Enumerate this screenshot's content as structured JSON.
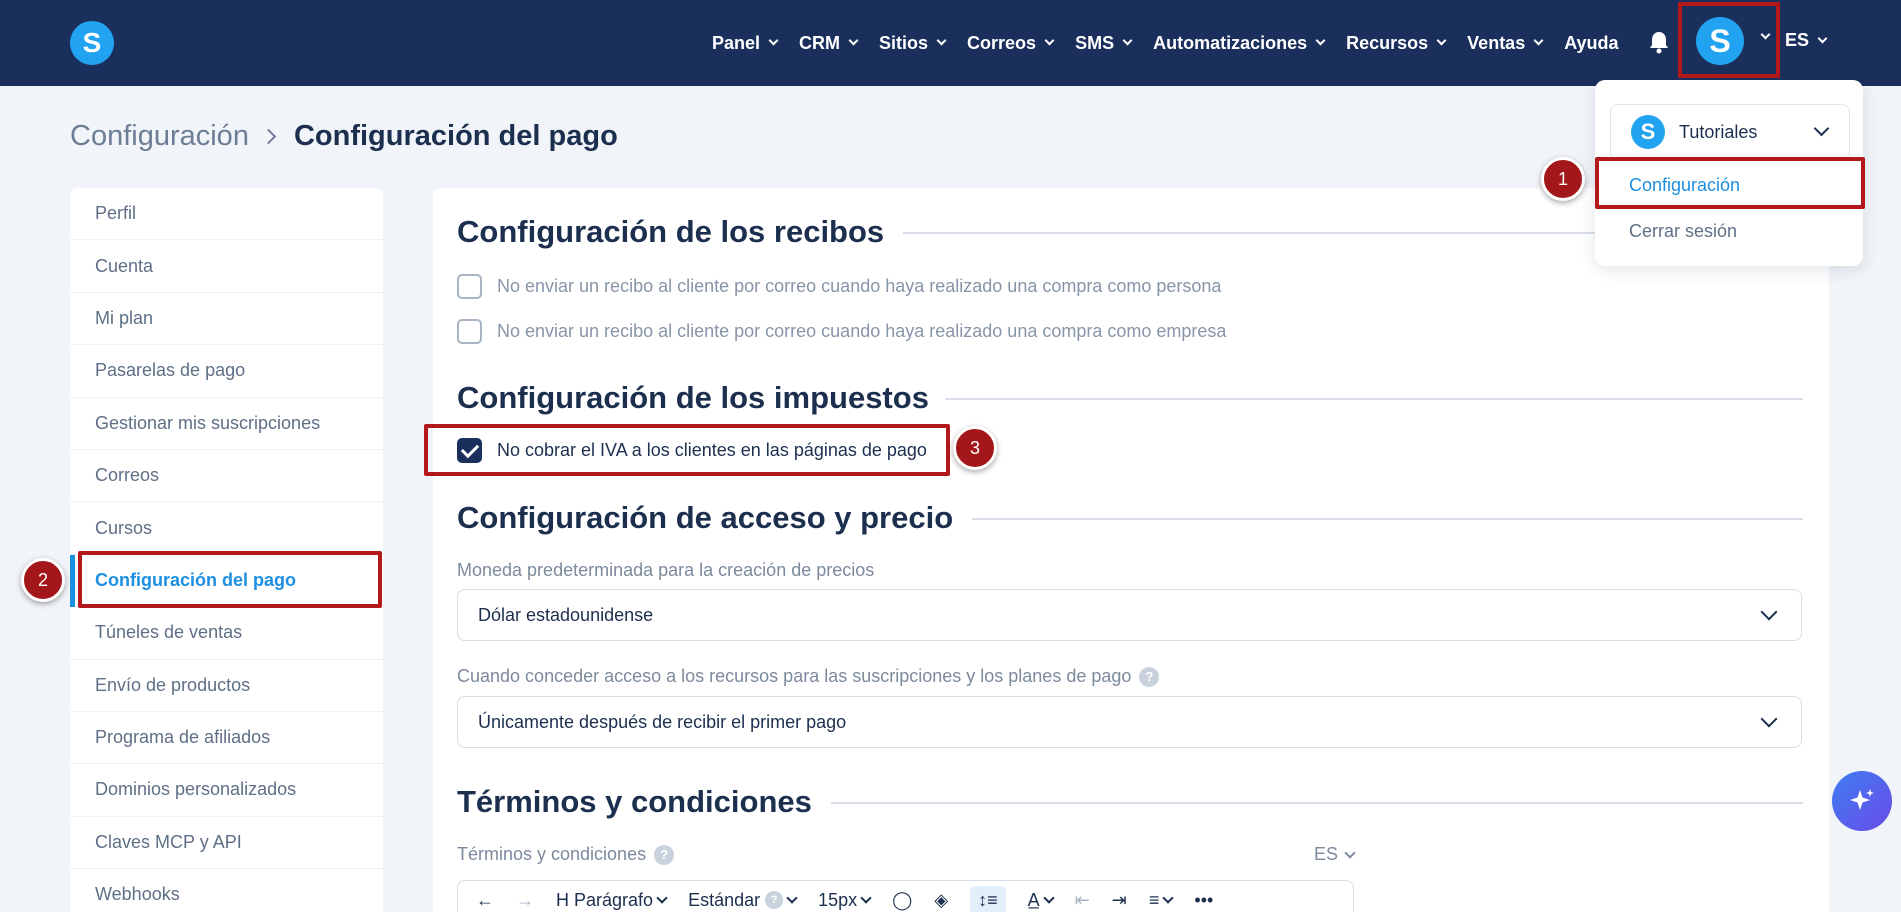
{
  "app": {
    "logo_letter": "S"
  },
  "nav": {
    "items": [
      {
        "label": "Panel",
        "has_dropdown": true
      },
      {
        "label": "CRM",
        "has_dropdown": true
      },
      {
        "label": "Sitios",
        "has_dropdown": true
      },
      {
        "label": "Correos",
        "has_dropdown": true
      },
      {
        "label": "SMS",
        "has_dropdown": true
      },
      {
        "label": "Automatizaciones",
        "has_dropdown": true
      },
      {
        "label": "Recursos",
        "has_dropdown": true
      },
      {
        "label": "Ventas",
        "has_dropdown": true
      },
      {
        "label": "Ayuda",
        "has_dropdown": false
      }
    ],
    "language": "ES",
    "avatar_letter": "S"
  },
  "breadcrumb": {
    "root": "Configuración",
    "current": "Configuración del pago"
  },
  "sidebar": {
    "items": [
      {
        "label": "Perfil"
      },
      {
        "label": "Cuenta"
      },
      {
        "label": "Mi plan"
      },
      {
        "label": "Pasarelas de pago"
      },
      {
        "label": "Gestionar mis suscripciones"
      },
      {
        "label": "Correos"
      },
      {
        "label": "Cursos"
      },
      {
        "label": "Configuración del pago"
      },
      {
        "label": "Túneles de ventas"
      },
      {
        "label": "Envío de productos"
      },
      {
        "label": "Programa de afiliados"
      },
      {
        "label": "Dominios personalizados"
      },
      {
        "label": "Claves MCP y API"
      },
      {
        "label": "Webhooks"
      }
    ],
    "active_index": 7
  },
  "main": {
    "receipts": {
      "title": "Configuración de los recibos",
      "options": [
        {
          "label": "No enviar un recibo al cliente por correo cuando haya realizado una compra como persona",
          "checked": false
        },
        {
          "label": "No enviar un recibo al cliente por correo cuando haya realizado una compra como empresa",
          "checked": false
        }
      ]
    },
    "taxes": {
      "title": "Configuración de los impuestos",
      "option": {
        "label": "No cobrar el IVA a los clientes en las páginas de pago",
        "checked": true
      }
    },
    "access": {
      "title": "Configuración de acceso y precio",
      "currency_label": "Moneda predeterminada para la creación de precios",
      "currency_value": "Dólar estadounidense",
      "access_label": "Cuando conceder acceso a los recursos para las suscripciones y los planes de pago",
      "access_value": "Únicamente después de recibir el primer pago",
      "help_glyph": "?"
    },
    "terms": {
      "title": "Términos y condiciones",
      "field_label": "Términos y condiciones",
      "language": "ES",
      "toolbar": {
        "block": "Parágrafo",
        "style": "Estándar",
        "font_size": "15px"
      }
    }
  },
  "account_menu": {
    "account_name": "Tutoriales",
    "settings_label": "Configuración",
    "logout_label": "Cerrar sesión"
  },
  "annotations": {
    "badges": [
      "1",
      "2",
      "3"
    ],
    "highlight_color": "#b3191b"
  },
  "colors": {
    "topbar": "#1b2f5c",
    "brand": "#22a3f2",
    "active": "#1d8fe0"
  }
}
